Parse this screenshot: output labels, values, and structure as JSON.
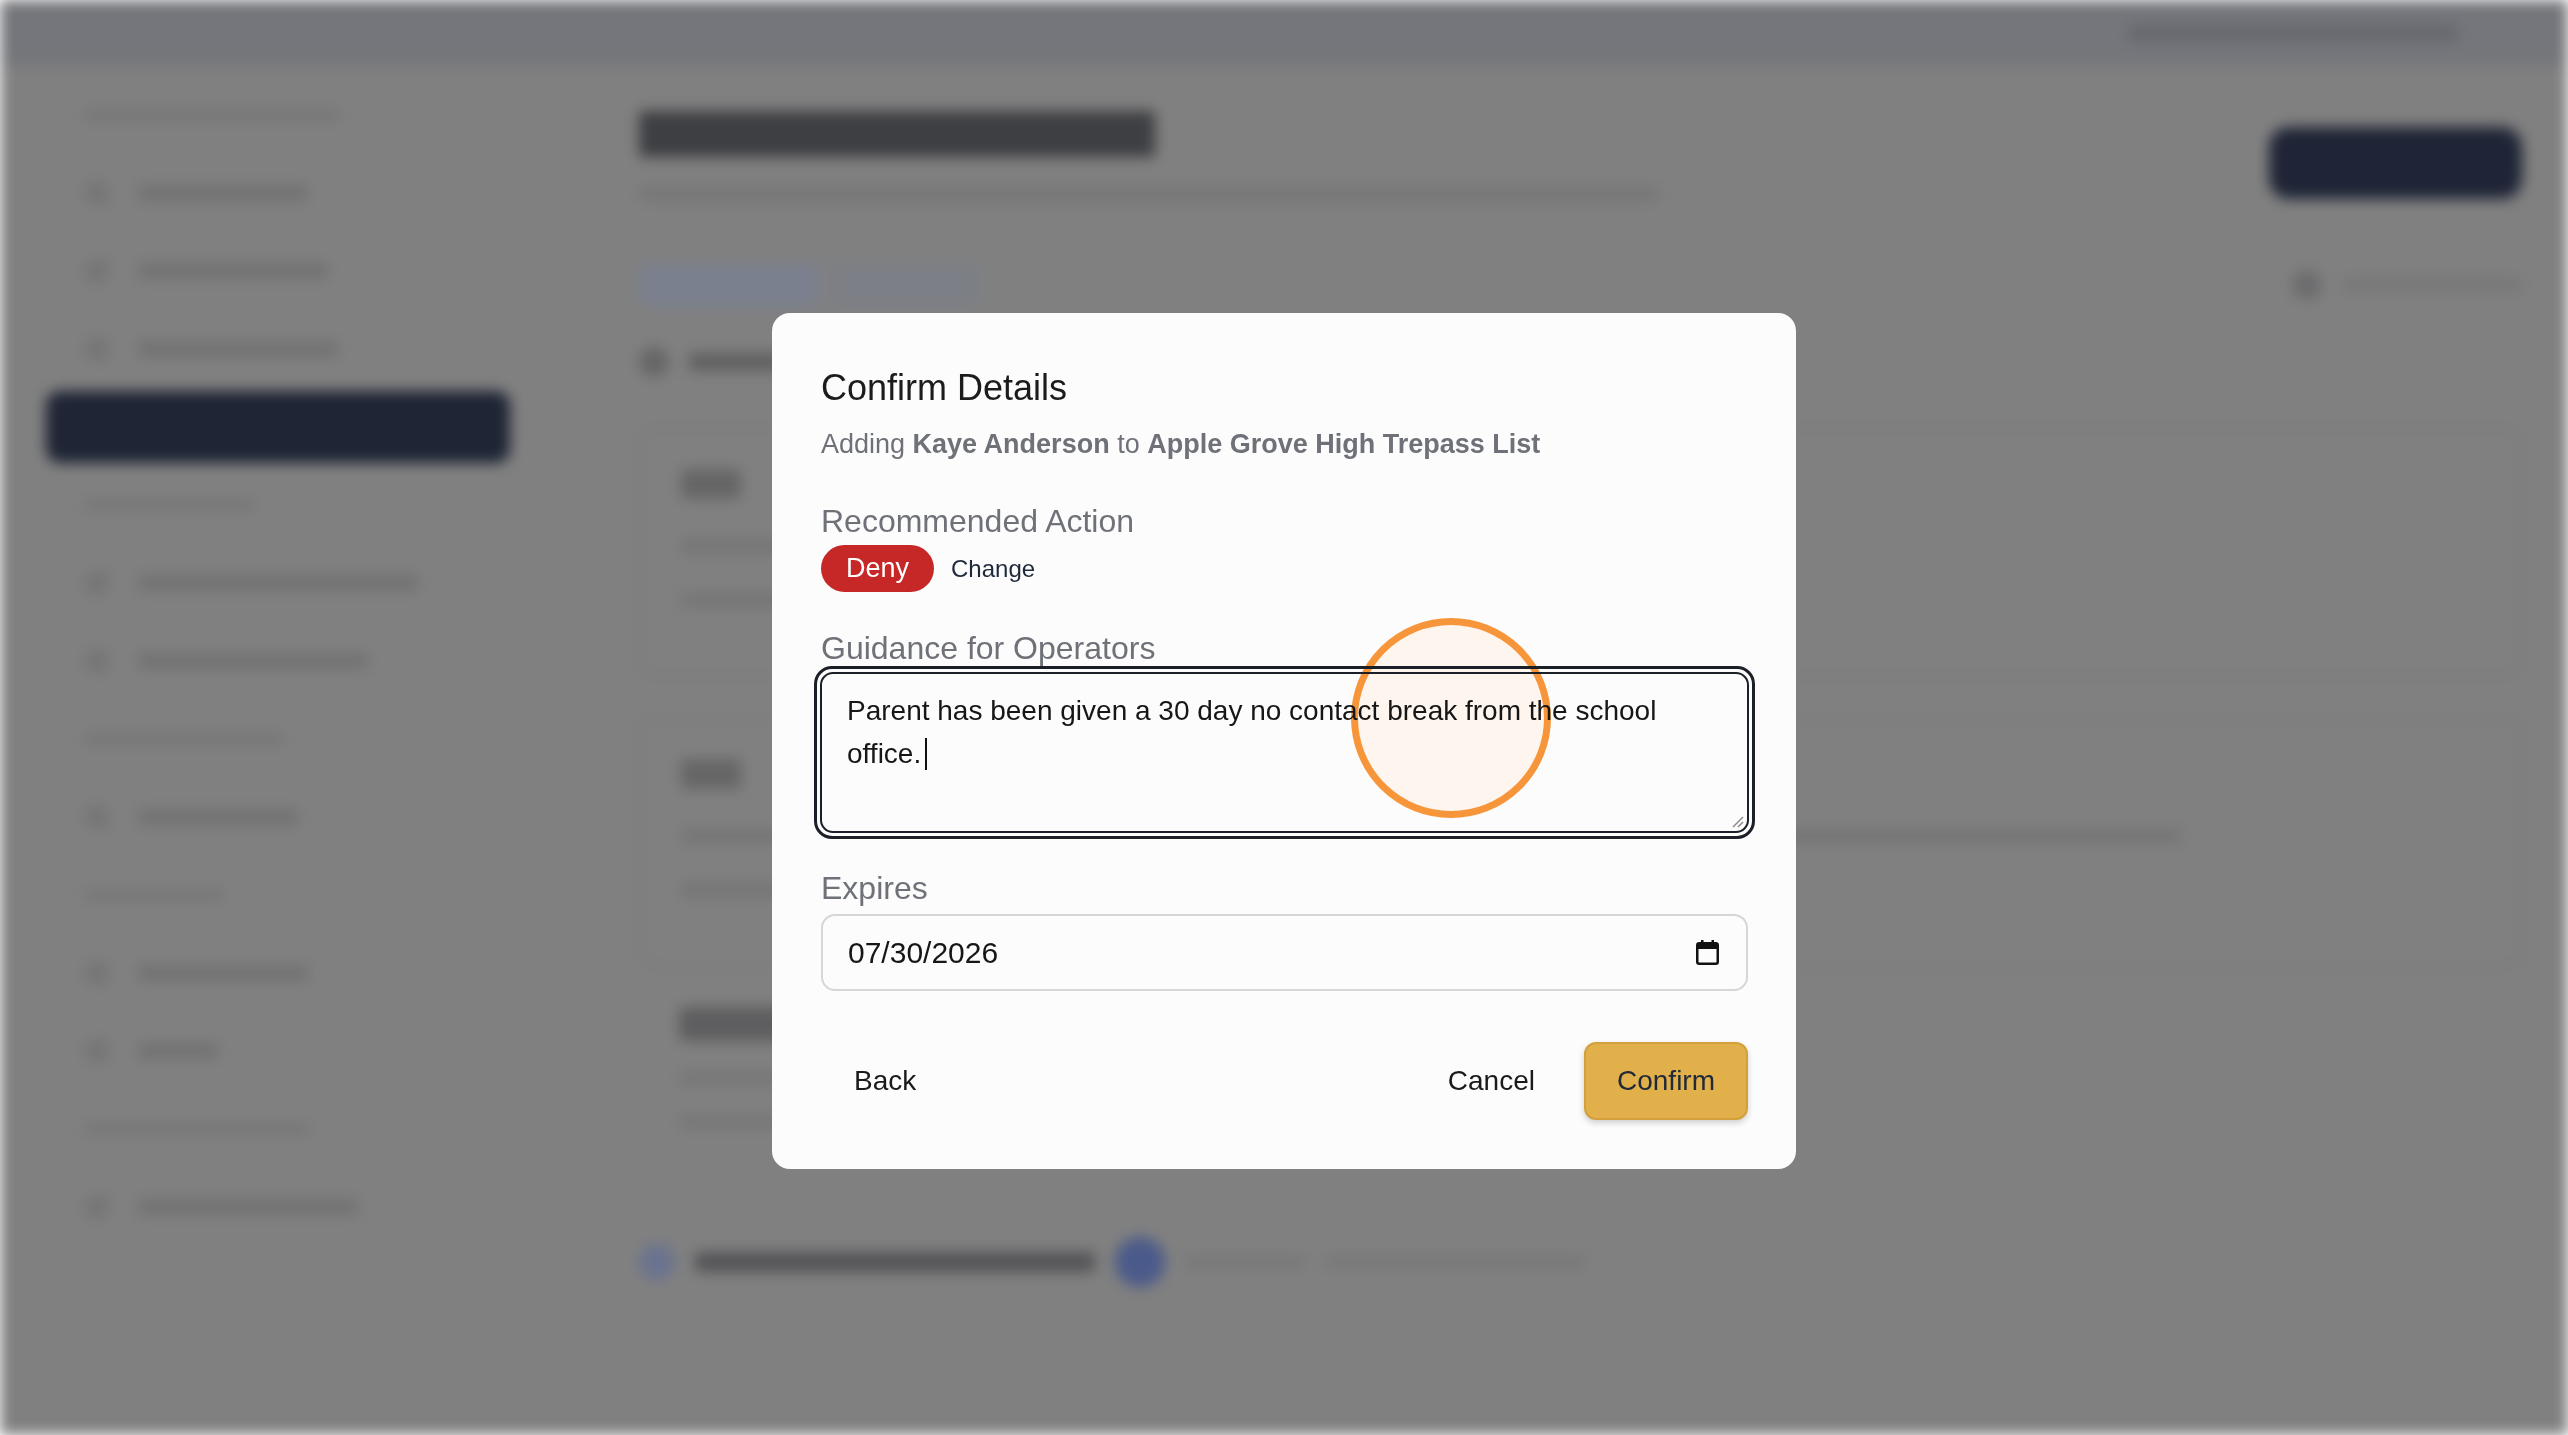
{
  "dialog": {
    "title": "Confirm Details",
    "subtitle": "Adding **Kaye Anderson** to **Apple Grove High Trepass List**",
    "recommended_action": {
      "label": "Recommended Action",
      "value": "Deny",
      "change_label": "Change"
    },
    "guidance": {
      "label": "Guidance for Operators",
      "value": "Parent has been given a 30 day no contact break from the school office.",
      "focused": true
    },
    "expires": {
      "label": "Expires",
      "value": "07/30/2026"
    },
    "footer": {
      "start": [
        {
          "label": "Back",
          "kind": "plain"
        }
      ],
      "end": [
        {
          "label": "Cancel",
          "kind": "plain"
        },
        {
          "label": "Confirm",
          "kind": "primary"
        }
      ]
    }
  }
}
